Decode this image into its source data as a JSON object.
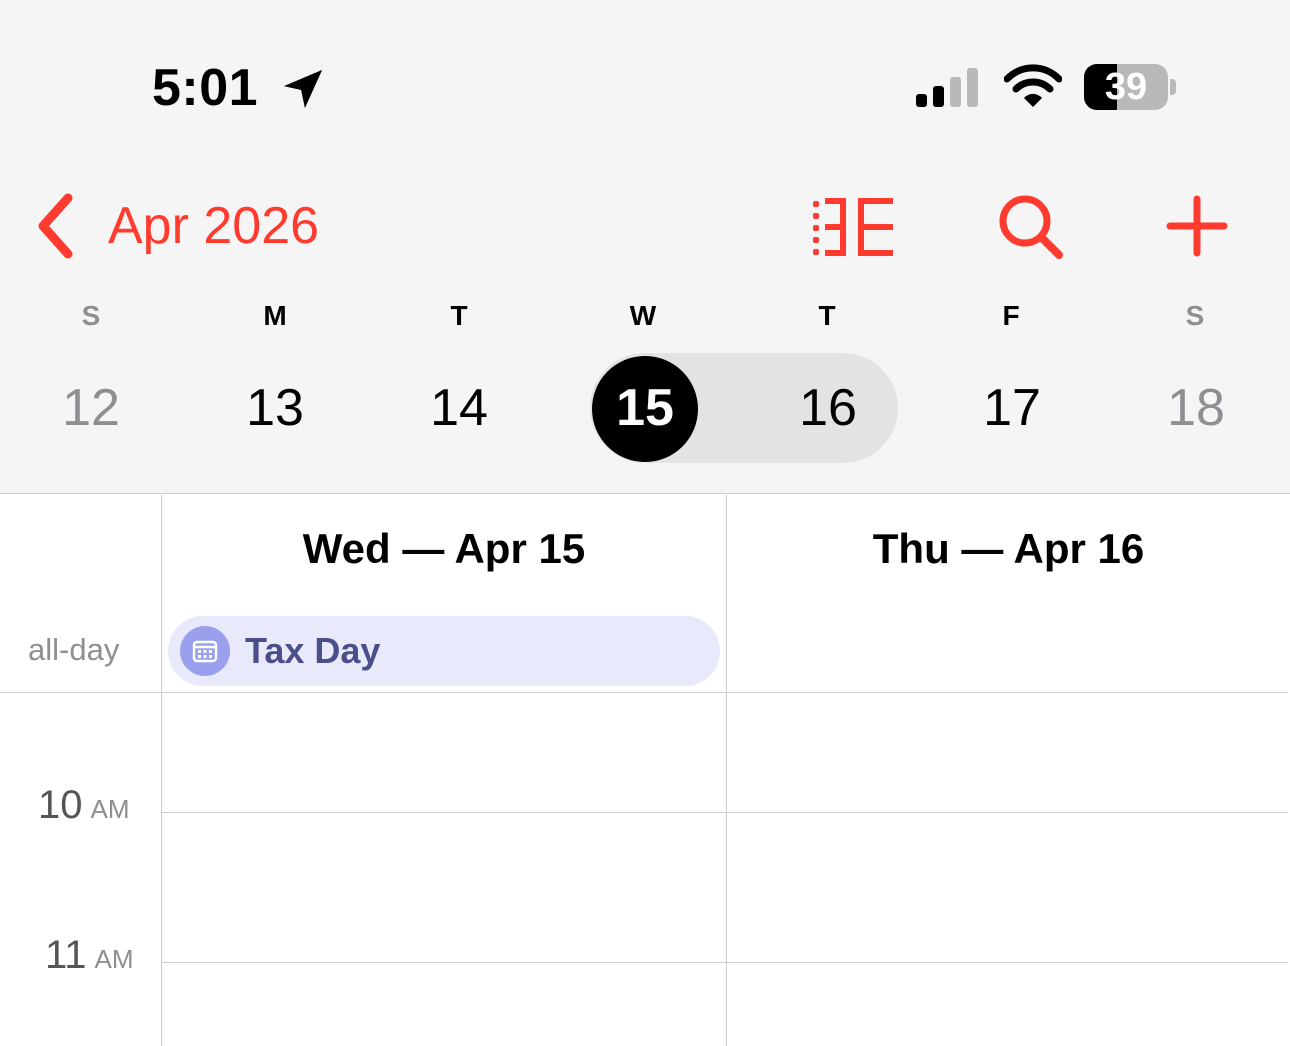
{
  "status_bar": {
    "time": "5:01",
    "battery_percent": "39",
    "battery_level": 0.39
  },
  "nav": {
    "month_title": "Apr 2026"
  },
  "toolbar_icons": [
    "view-toggle-icon",
    "search-icon",
    "plus-icon"
  ],
  "week": {
    "weekday_letters": [
      "S",
      "M",
      "T",
      "W",
      "T",
      "F",
      "S"
    ],
    "dates": [
      "12",
      "13",
      "14",
      "15",
      "16",
      "17",
      "18"
    ],
    "selected_date": "15",
    "range_end": "16"
  },
  "columns": {
    "day1_title": "Wed — Apr 15",
    "day2_title": "Thu — Apr 16"
  },
  "all_day": {
    "label": "all-day",
    "event_title": "Tax Day"
  },
  "hours": [
    {
      "number": "10",
      "suffix": "AM"
    },
    {
      "number": "11",
      "suffix": "AM"
    }
  ],
  "colors": {
    "accent": "#ff3b30",
    "event_bg": "#e8e9fb",
    "event_text": "#4a4f8c",
    "grid": "#cfcfd3"
  }
}
